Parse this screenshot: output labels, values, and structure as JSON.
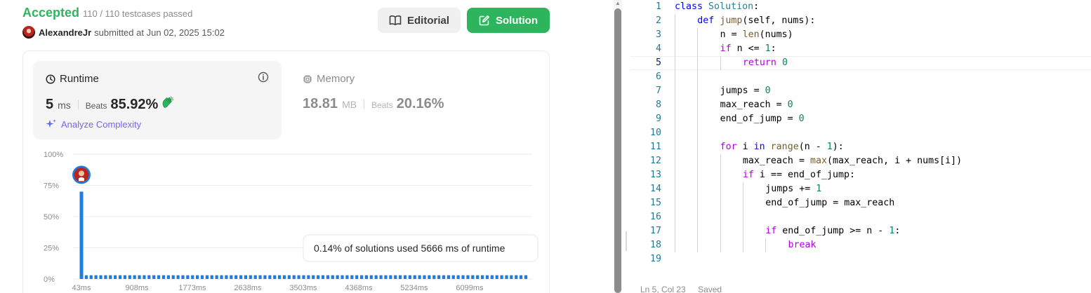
{
  "submission": {
    "status": "Accepted",
    "testcases": "110 / 110 testcases passed",
    "username": "AlexandreJr",
    "submitted_text": "submitted at Jun 02, 2025 15:02"
  },
  "buttons": {
    "editorial": "Editorial",
    "solution": "Solution"
  },
  "runtime": {
    "label": "Runtime",
    "value": "5",
    "unit": "ms",
    "beats_label": "Beats",
    "beats_value": "85.92%",
    "analyze_label": "Analyze Complexity"
  },
  "memory": {
    "label": "Memory",
    "value": "18.81",
    "unit": "MB",
    "beats_label": "Beats",
    "beats_value": "20.16%"
  },
  "chart_data": {
    "type": "bar",
    "ylabel_ticks": [
      "100%",
      "75%",
      "50%",
      "25%",
      "0%"
    ],
    "ylim": [
      0,
      100
    ],
    "x_tick_labels": [
      "43ms",
      "908ms",
      "1773ms",
      "2638ms",
      "3503ms",
      "4368ms",
      "5234ms",
      "6099ms"
    ],
    "values": [
      70,
      3,
      3,
      3,
      3,
      3,
      3,
      3,
      3,
      3,
      3,
      3,
      3,
      3,
      3,
      3,
      3,
      3,
      3,
      3,
      3,
      3,
      3,
      3,
      3,
      3,
      3,
      3,
      3,
      3,
      3,
      3,
      3,
      3,
      3,
      3,
      3,
      3,
      3,
      3,
      3,
      3,
      3,
      3,
      3,
      3,
      3,
      3,
      3,
      3,
      3,
      3,
      3,
      3,
      3,
      3,
      3,
      3,
      3,
      3,
      3,
      3,
      3,
      3,
      3,
      3,
      3,
      3,
      3,
      3,
      3,
      3,
      3,
      3,
      3,
      3,
      3,
      3,
      3,
      3,
      3,
      3,
      3,
      3,
      3,
      3,
      3,
      3,
      3,
      3,
      3,
      3,
      3
    ],
    "highlighted_index": 0,
    "tooltip": "0.14% of solutions used 5666 ms of runtime",
    "bar_color": "#1a7fe0",
    "grid": true
  },
  "editor": {
    "lines": [
      {
        "n": "1",
        "indent": 0,
        "tokens": [
          [
            "kw",
            "class "
          ],
          [
            "cls",
            "Solution"
          ],
          [
            "",
            ""
          ],
          [
            "",
            ":"
          ]
        ]
      },
      {
        "n": "2",
        "indent": 1,
        "tokens": [
          [
            "kw",
            "def "
          ],
          [
            "fn",
            "jump"
          ],
          [
            "",
            "(self, nums):"
          ]
        ]
      },
      {
        "n": "3",
        "indent": 2,
        "tokens": [
          [
            "",
            "n = "
          ],
          [
            "fn",
            "len"
          ],
          [
            "",
            "(nums)"
          ]
        ]
      },
      {
        "n": "4",
        "indent": 2,
        "tokens": [
          [
            "kc",
            "if "
          ],
          [
            "",
            "n <= "
          ],
          [
            "num",
            "1"
          ],
          [
            "",
            ":"
          ]
        ]
      },
      {
        "n": "5",
        "indent": 3,
        "tokens": [
          [
            "kc",
            "return "
          ],
          [
            "num",
            "0"
          ]
        ]
      },
      {
        "n": "6",
        "indent": 0,
        "tokens": []
      },
      {
        "n": "7",
        "indent": 2,
        "tokens": [
          [
            "",
            "jumps = "
          ],
          [
            "num",
            "0"
          ]
        ]
      },
      {
        "n": "8",
        "indent": 2,
        "tokens": [
          [
            "",
            "max_reach = "
          ],
          [
            "num",
            "0"
          ]
        ]
      },
      {
        "n": "9",
        "indent": 2,
        "tokens": [
          [
            "",
            "end_of_jump = "
          ],
          [
            "num",
            "0"
          ]
        ]
      },
      {
        "n": "10",
        "indent": 0,
        "tokens": []
      },
      {
        "n": "11",
        "indent": 2,
        "tokens": [
          [
            "kc",
            "for "
          ],
          [
            "",
            "i "
          ],
          [
            "kw",
            "in "
          ],
          [
            "fn",
            "range"
          ],
          [
            "",
            "(n - "
          ],
          [
            "num",
            "1"
          ],
          [
            "",
            "):"
          ]
        ]
      },
      {
        "n": "12",
        "indent": 3,
        "tokens": [
          [
            "",
            "max_reach = "
          ],
          [
            "fn",
            "max"
          ],
          [
            "",
            "(max_reach, i + nums[i])"
          ]
        ]
      },
      {
        "n": "13",
        "indent": 3,
        "tokens": [
          [
            "kc",
            "if "
          ],
          [
            "",
            "i == end_of_jump:"
          ]
        ]
      },
      {
        "n": "14",
        "indent": 4,
        "tokens": [
          [
            "",
            "jumps += "
          ],
          [
            "num",
            "1"
          ]
        ]
      },
      {
        "n": "15",
        "indent": 4,
        "tokens": [
          [
            "",
            "end_of_jump = max_reach"
          ]
        ]
      },
      {
        "n": "16",
        "indent": 0,
        "tokens": []
      },
      {
        "n": "17",
        "indent": 4,
        "tokens": [
          [
            "kc",
            "if "
          ],
          [
            "",
            "end_of_jump >= n - "
          ],
          [
            "num",
            "1"
          ],
          [
            "",
            ":"
          ]
        ]
      },
      {
        "n": "18",
        "indent": 5,
        "tokens": [
          [
            "kc",
            "break"
          ]
        ]
      },
      {
        "n": "19",
        "indent": 0,
        "tokens": []
      }
    ],
    "active_line": "5",
    "status": {
      "position": "Ln 5, Col 23",
      "saved": "Saved"
    }
  },
  "colors": {
    "accepted": "#2db55d",
    "solution_button": "#2db55d",
    "analyze": "#7b61ff"
  }
}
